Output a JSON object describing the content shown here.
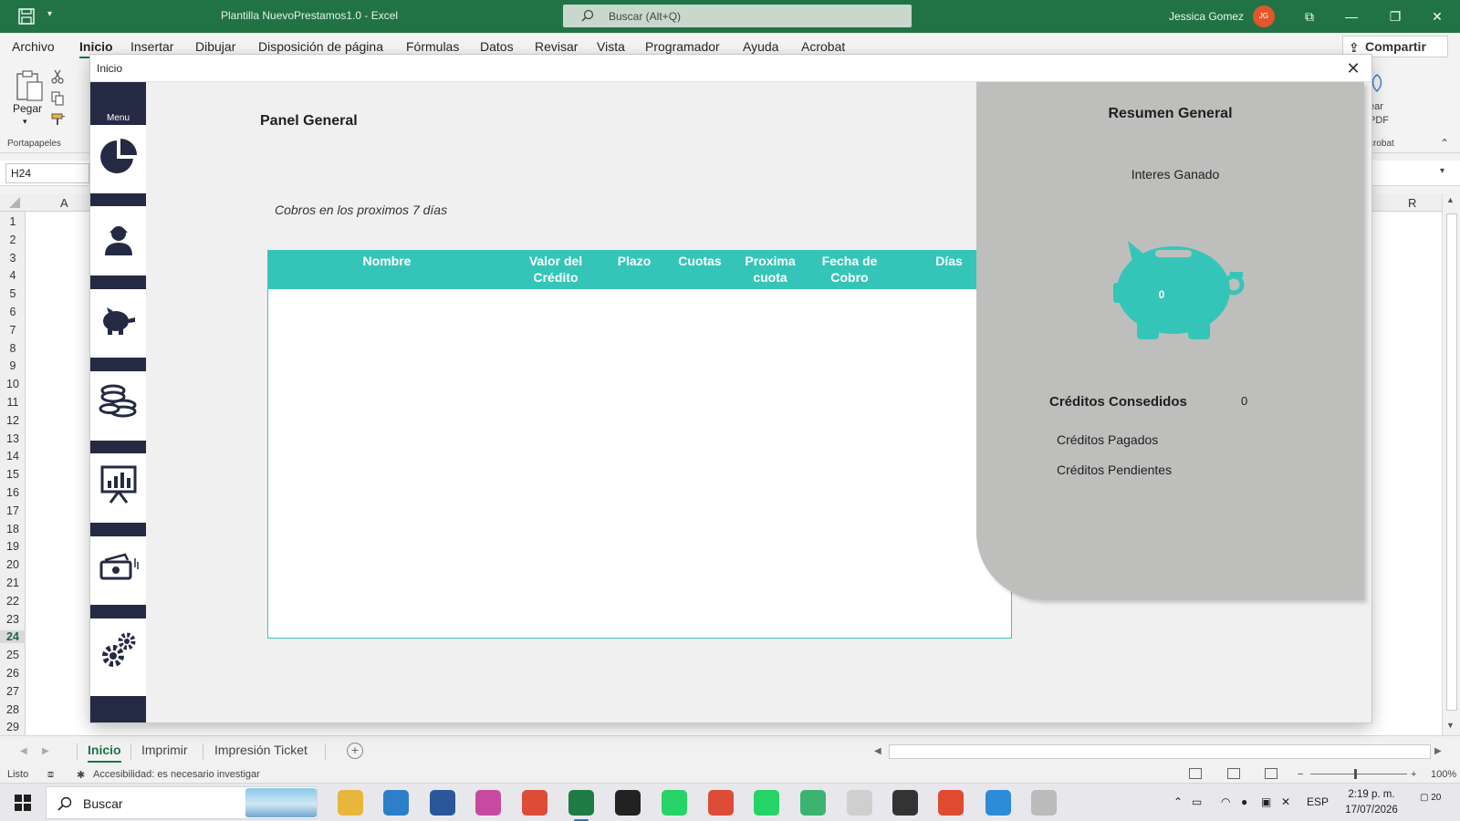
{
  "excel": {
    "doc_title": "Plantilla NuevoPrestamos1.0  -  Excel",
    "search_placeholder": "Buscar (Alt+Q)",
    "user_name": "Jessica Gomez",
    "user_initials": "JG",
    "tabs": [
      "Archivo",
      "Inicio",
      "Insertar",
      "Dibujar",
      "Disposición de página",
      "Fórmulas",
      "Datos",
      "Revisar",
      "Vista",
      "Programador",
      "Ayuda",
      "Acrobat"
    ],
    "active_tab": "Inicio",
    "share_label": "Compartir",
    "ribbon": {
      "paste_label": "Pegar",
      "clipboard_group": "Portapapeles",
      "pdf_label_1": "ear",
      "pdf_label_2": "PDF",
      "acrobat_group": "crobat"
    },
    "name_box": "H24",
    "columns": [
      "A",
      "R"
    ],
    "rows": [
      "1",
      "2",
      "3",
      "4",
      "5",
      "6",
      "7",
      "8",
      "9",
      "10",
      "11",
      "12",
      "13",
      "14",
      "15",
      "16",
      "17",
      "18",
      "19",
      "20",
      "21",
      "22",
      "23",
      "24",
      "25",
      "26",
      "27",
      "28",
      "29"
    ],
    "selected_row": "24",
    "sheet_tabs": [
      "Inicio",
      "Imprimir",
      "Impresión Ticket"
    ],
    "active_sheet": "Inicio",
    "status_ready": "Listo",
    "status_accessibility": "Accesibilidad: es necesario investigar",
    "zoom": "100%"
  },
  "taskbar": {
    "search_label": "Buscar",
    "language": "ESP",
    "time": "2:19 p. m.",
    "date": "17/07/2026",
    "notification_count": "20",
    "apps": [
      "file-explorer",
      "edge",
      "word",
      "snipping",
      "chrome",
      "excel",
      "obs",
      "whatsapp",
      "chrome-profile",
      "whatsapp-business",
      "drive",
      "app-circle",
      "notes",
      "outlook-profile",
      "paint",
      "brush-app"
    ]
  },
  "dialog": {
    "title": "Inicio",
    "menu_label": "Menu",
    "menu_items": [
      "dashboard",
      "clients",
      "savings",
      "coins",
      "reports",
      "payments",
      "settings"
    ],
    "panel_title": "Panel General",
    "subtitle": "Cobros en los proximos 7 días",
    "table": {
      "headers": [
        [
          "Nombre"
        ],
        [
          "Valor del",
          "Crédito"
        ],
        [
          "Plazo"
        ],
        [
          "Cuotas"
        ],
        [
          "Proxima",
          "cuota"
        ],
        [
          "Fecha de",
          "Cobro"
        ],
        [
          "Días"
        ]
      ],
      "rows": []
    },
    "summary": {
      "title": "Resumen General",
      "interest_label": "Interes Ganado",
      "interest_value": "0",
      "credits_label": "Créditos Consedidos",
      "credits_value": "0",
      "paid_label": "Créditos Pagados",
      "pending_label": "Créditos Pendientes"
    }
  },
  "colors": {
    "excel_green": "#217346",
    "menu_navy": "#252a44",
    "teal": "#35c5b8",
    "summary_gray": "#bebfbd"
  }
}
